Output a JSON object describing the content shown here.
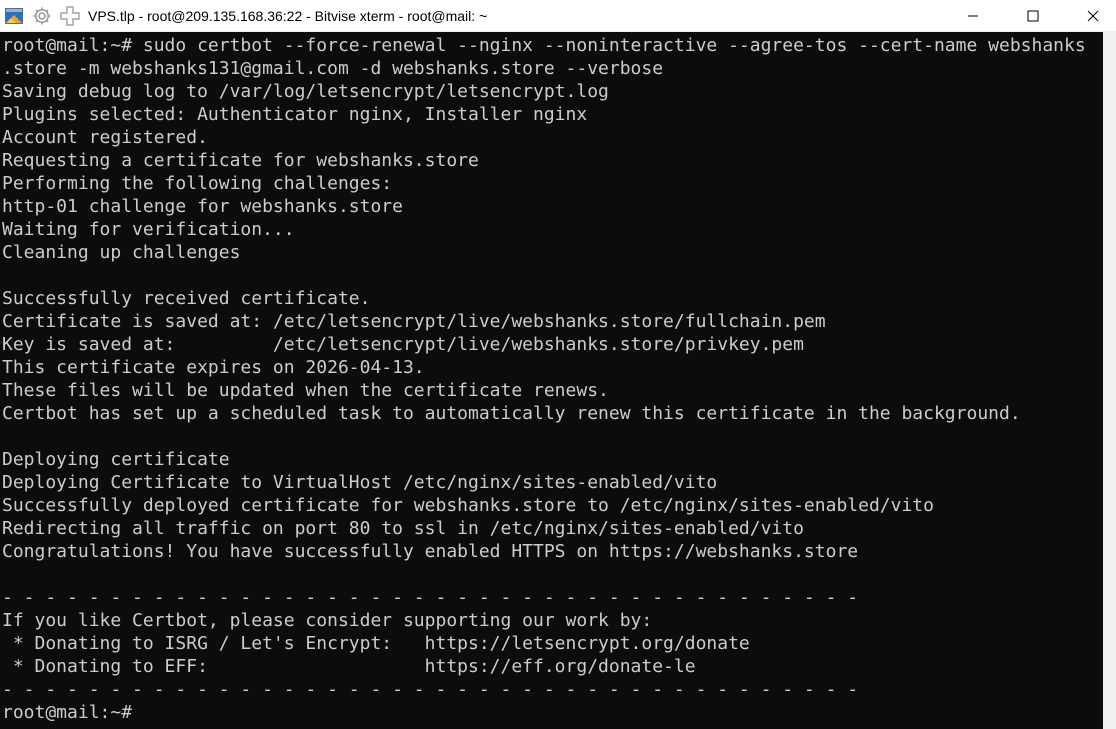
{
  "window": {
    "title": "VPS.tlp - root@209.135.168.36:22 - Bitvise xterm - root@mail: ~"
  },
  "titlebar_icons": [
    "terminal-icon",
    "gear-icon",
    "new-window-icon"
  ],
  "colors": {
    "terminal_bg": "#0c0c0c",
    "terminal_fg": "#cccccc"
  },
  "terminal": {
    "lines": [
      "root@mail:~# sudo certbot --force-renewal --nginx --noninteractive --agree-tos --cert-name webshanks",
      ".store -m webshanks131@gmail.com -d webshanks.store --verbose",
      "Saving debug log to /var/log/letsencrypt/letsencrypt.log",
      "Plugins selected: Authenticator nginx, Installer nginx",
      "Account registered.",
      "Requesting a certificate for webshanks.store",
      "Performing the following challenges:",
      "http-01 challenge for webshanks.store",
      "Waiting for verification...",
      "Cleaning up challenges",
      "",
      "Successfully received certificate.",
      "Certificate is saved at: /etc/letsencrypt/live/webshanks.store/fullchain.pem",
      "Key is saved at:         /etc/letsencrypt/live/webshanks.store/privkey.pem",
      "This certificate expires on 2026-04-13.",
      "These files will be updated when the certificate renews.",
      "Certbot has set up a scheduled task to automatically renew this certificate in the background.",
      "",
      "Deploying certificate",
      "Deploying Certificate to VirtualHost /etc/nginx/sites-enabled/vito",
      "Successfully deployed certificate for webshanks.store to /etc/nginx/sites-enabled/vito",
      "Redirecting all traffic on port 80 to ssl in /etc/nginx/sites-enabled/vito",
      "Congratulations! You have successfully enabled HTTPS on https://webshanks.store",
      "",
      "- - - - - - - - - - - - - - - - - - - - - - - - - - - - - - - - - - - - - - - -",
      "If you like Certbot, please consider supporting our work by:",
      " * Donating to ISRG / Let's Encrypt:   https://letsencrypt.org/donate",
      " * Donating to EFF:                    https://eff.org/donate-le",
      "- - - - - - - - - - - - - - - - - - - - - - - - - - - - - - - - - - - - - - - -",
      "root@mail:~#"
    ]
  }
}
